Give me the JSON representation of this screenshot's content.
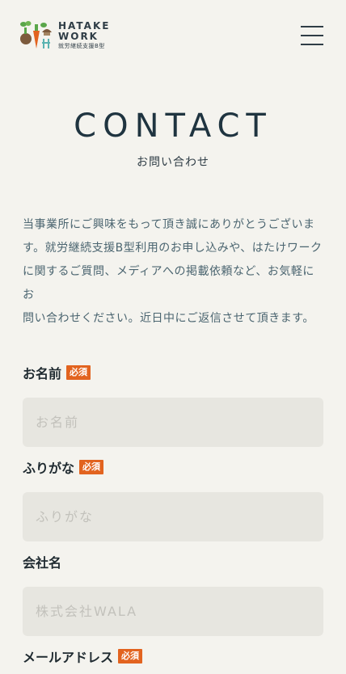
{
  "header": {
    "logo_name_line1": "HATAKE",
    "logo_name_line2": "WORK",
    "logo_sub": "就労継続支援B型",
    "menu_icon": "hamburger-icon"
  },
  "hero": {
    "title": "CONTACT",
    "subtitle": "お問い合わせ"
  },
  "intro": {
    "lines": [
      "当事業所にご興味をもって頂き誠にありがとうございま",
      "す。就労継続支援B型利用のお申し込みや、はたけワーク",
      "に関するご質問、メディアへの掲載依頼など、お気軽にお",
      "問い合わせください。近日中にご返信させて頂きます。"
    ]
  },
  "form": {
    "required_badge": "必須",
    "name": {
      "label": "お名前",
      "placeholder": "お名前",
      "value": ""
    },
    "furigana": {
      "label": "ふりがな",
      "placeholder": "ふりがな",
      "value": ""
    },
    "company": {
      "label": "会社名",
      "placeholder": "株式会社WALA",
      "value": ""
    },
    "email": {
      "label": "メールアドレス"
    }
  },
  "colors": {
    "background": "#f4f3ee",
    "heading": "#1f3440",
    "body_text": "#4b6570",
    "required_badge": "#e2631f",
    "input_bg": "#e7e6e0"
  }
}
